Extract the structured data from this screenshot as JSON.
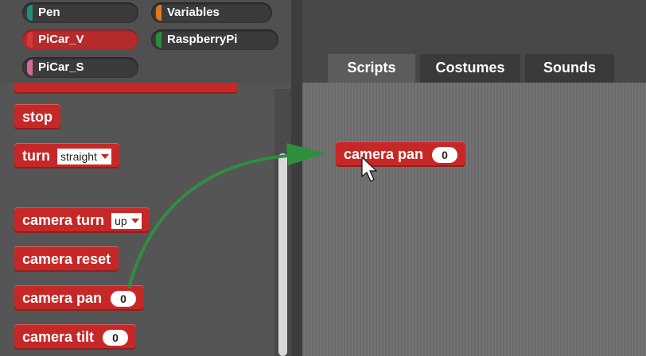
{
  "categories": [
    {
      "label": "Pen",
      "swatch": "#1f8f7a",
      "selected": false
    },
    {
      "label": "Variables",
      "swatch": "#e07a1a",
      "selected": false
    },
    {
      "label": "PiCar_V",
      "swatch": "#d43a3a",
      "selected": true
    },
    {
      "label": "RaspberryPi",
      "swatch": "#2e8b3a",
      "selected": false
    },
    {
      "label": "PiCar_S",
      "swatch": "#d46a9a",
      "selected": false
    }
  ],
  "palette": {
    "stop": "stop",
    "turn": "turn",
    "turn_option": "straight",
    "camera_turn": "camera turn",
    "camera_turn_option": "up",
    "camera_reset": "camera reset",
    "camera_pan": "camera pan",
    "camera_pan_value": "0",
    "camera_tilt": "camera tilt",
    "camera_tilt_value": "0"
  },
  "tabs": [
    "Scripts",
    "Costumes",
    "Sounds"
  ],
  "script": {
    "block_label": "camera pan",
    "block_value": "0"
  },
  "colors": {
    "block": "#c62828",
    "arrow": "#2f8f3f"
  }
}
